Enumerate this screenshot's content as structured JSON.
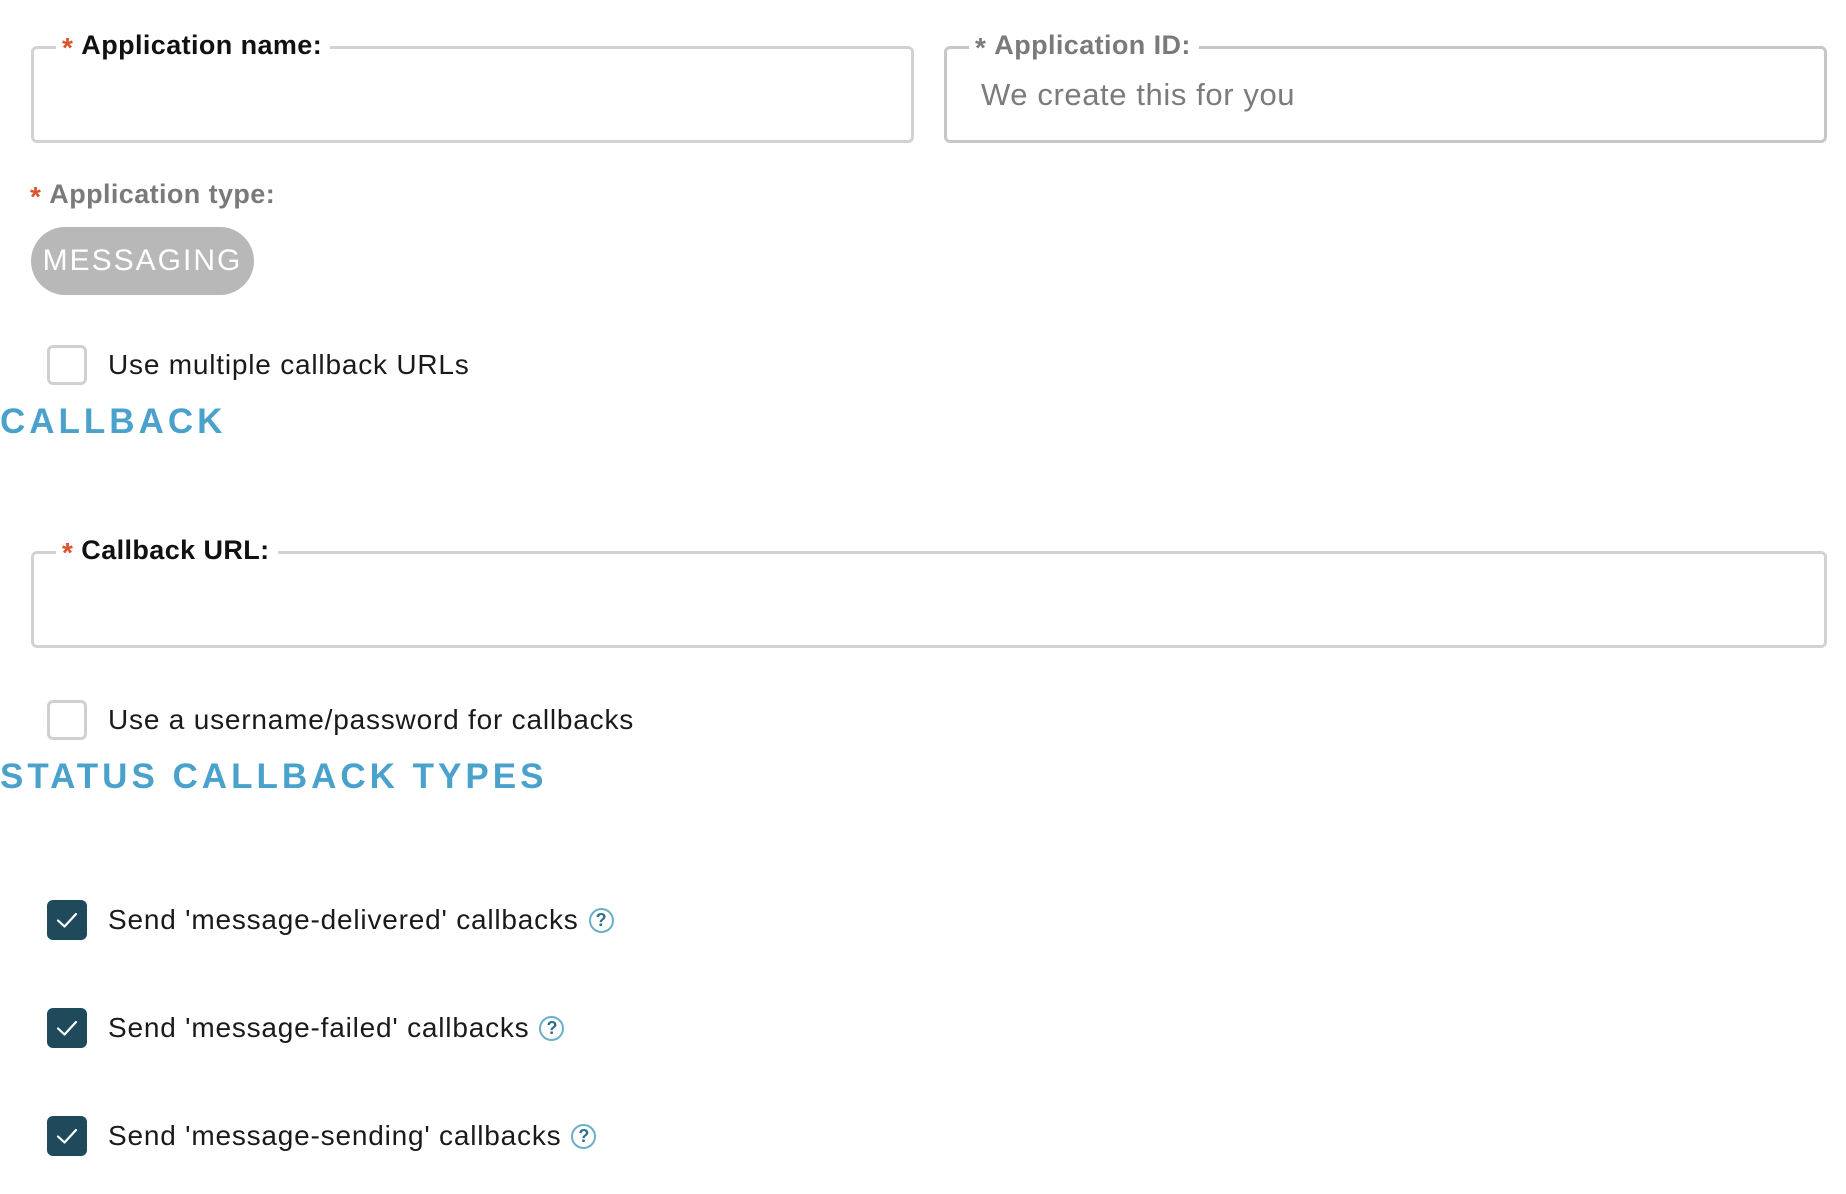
{
  "application_name": {
    "required_marker": "*",
    "label": "Application name:",
    "value": ""
  },
  "application_id": {
    "required_marker": "*",
    "label": "Application ID:",
    "placeholder": "We create this for you"
  },
  "application_type": {
    "required_marker": "*",
    "label": "Application type:",
    "selected": "MESSAGING"
  },
  "multiple_callbacks": {
    "label": "Use multiple callback URLs",
    "checked": false
  },
  "callback_section": {
    "title": "CALLBACK",
    "callback_url": {
      "required_marker": "*",
      "label": "Callback URL:",
      "value": ""
    },
    "auth_option": {
      "label": "Use a username/password for callbacks",
      "checked": false
    }
  },
  "status_section": {
    "title": "STATUS CALLBACK TYPES",
    "items": [
      {
        "label": "Send 'message-delivered' callbacks",
        "checked": true,
        "help": "?"
      },
      {
        "label": "Send 'message-failed' callbacks",
        "checked": true,
        "help": "?"
      },
      {
        "label": "Send 'message-sending' callbacks",
        "checked": true,
        "help": "?"
      }
    ]
  },
  "colors": {
    "accent": "#4aa2cc",
    "required": "#d9532b",
    "checkbox_checked": "#1e4a5c",
    "pill_bg": "#b8b8b8"
  },
  "icons": {
    "checkmark": "check-icon",
    "help": "help-icon"
  }
}
